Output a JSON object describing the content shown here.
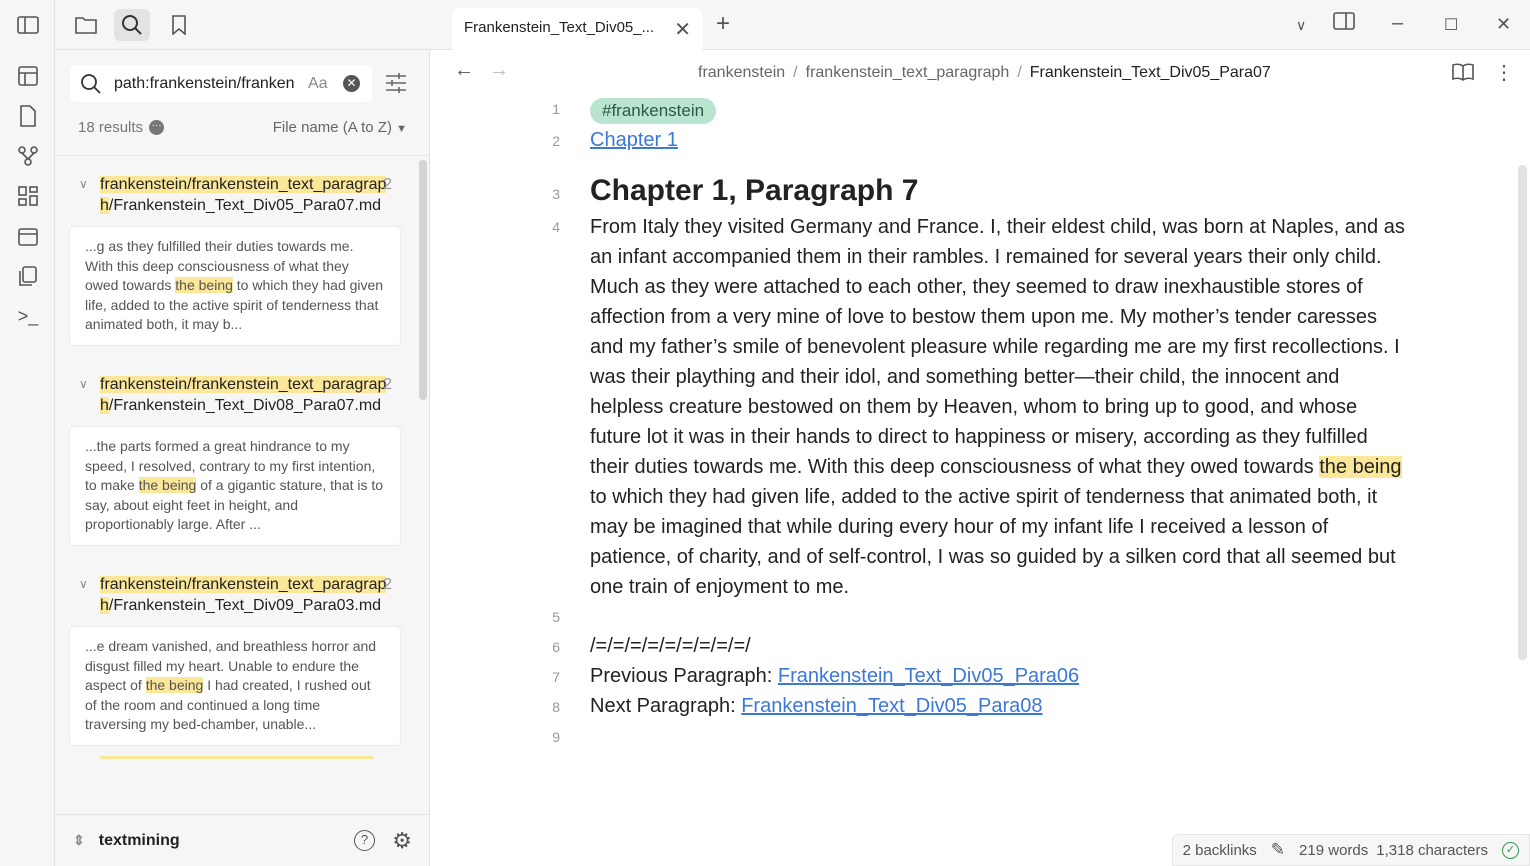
{
  "sidebar": {
    "search_query": "path:frankenstein/franken",
    "match_case_label": "Aa",
    "results_count": "18 results",
    "sort_label": "File name (A to Z)",
    "results": [
      {
        "path_highlight": "frankenstein/frankenstein_text_paragraph",
        "path_rest": "/Frankenstein_Text_Div05_Para07.md",
        "count": "2",
        "snippet_before": "...g as they fulfilled their duties towards me. With this deep consciousness of what they owed towards ",
        "snippet_match": "the being",
        "snippet_after": " to which they had given life, added to the active spirit of tenderness that animated both, it may b..."
      },
      {
        "path_highlight": "frankenstein/frankenstein_text_paragraph",
        "path_rest": "/Frankenstein_Text_Div08_Para07.md",
        "count": "2",
        "snippet_before": "...the parts formed a great hindrance to my speed, I resolved, contrary to my first intention, to make ",
        "snippet_match": "the being",
        "snippet_after": " of a gigantic stature, that is to say, about eight feet in height, and proportionably large. After ..."
      },
      {
        "path_highlight": "frankenstein/frankenstein_text_paragraph",
        "path_rest": "/Frankenstein_Text_Div09_Para03.md",
        "count": "2",
        "snippet_before": "...e dream vanished, and breathless horror and disgust filled my heart. Unable to endure the aspect of ",
        "snippet_match": "the being",
        "snippet_after": " I had created, I rushed out of the room and continued a long time traversing my bed-chamber, unable..."
      }
    ],
    "vault_name": "textmining"
  },
  "tab": {
    "title": "Frankenstein_Text_Div05_..."
  },
  "breadcrumb": [
    "frankenstein",
    "frankenstein_text_paragraph",
    "Frankenstein_Text_Div05_Para07"
  ],
  "editor": {
    "line_numbers": [
      "1",
      "2",
      "3",
      "4",
      "5",
      "6",
      "7",
      "8",
      "9"
    ],
    "tag": "#frankenstein",
    "chapter_link": "Chapter 1",
    "heading": "Chapter 1, Paragraph 7",
    "para_before": "From Italy they visited Germany and France. I, their eldest child, was born at Naples, and as an infant accompanied them in their rambles. I remained for several years their only child. Much as they were attached to each other, they seemed to draw inexhaustible stores of affection from a very mine of love to bestow them upon me. My mother’s tender caresses and my father’s smile of benevolent pleasure while regarding me are my first recollections. I was their plaything and their idol, and something better—their child, the innocent and helpless creature bestowed on them by Heaven, whom to bring up to good, and whose future lot it was in their hands to direct to happiness or misery, according as they fulfilled their duties towards me. With this deep consciousness of what they owed towards ",
    "para_match": "the being",
    "para_after": " to which they had given life, added to the active spirit of tenderness that animated both, it may be imagined that while during every hour of my infant life I received a lesson of patience, of charity, and of self-control, I was so guided by a silken cord that all seemed but one train of enjoyment to me.",
    "separator": "/=/=/=/=/=/=/=/=/=/",
    "prev_label": "Previous Paragraph: ",
    "prev_link": "Frankenstein_Text_Div05_Para06",
    "next_label": "Next Paragraph: ",
    "next_link": "Frankenstein_Text_Div05_Para08"
  },
  "status": {
    "backlinks": "2 backlinks",
    "words": "219 words",
    "characters": "1,318 characters"
  }
}
